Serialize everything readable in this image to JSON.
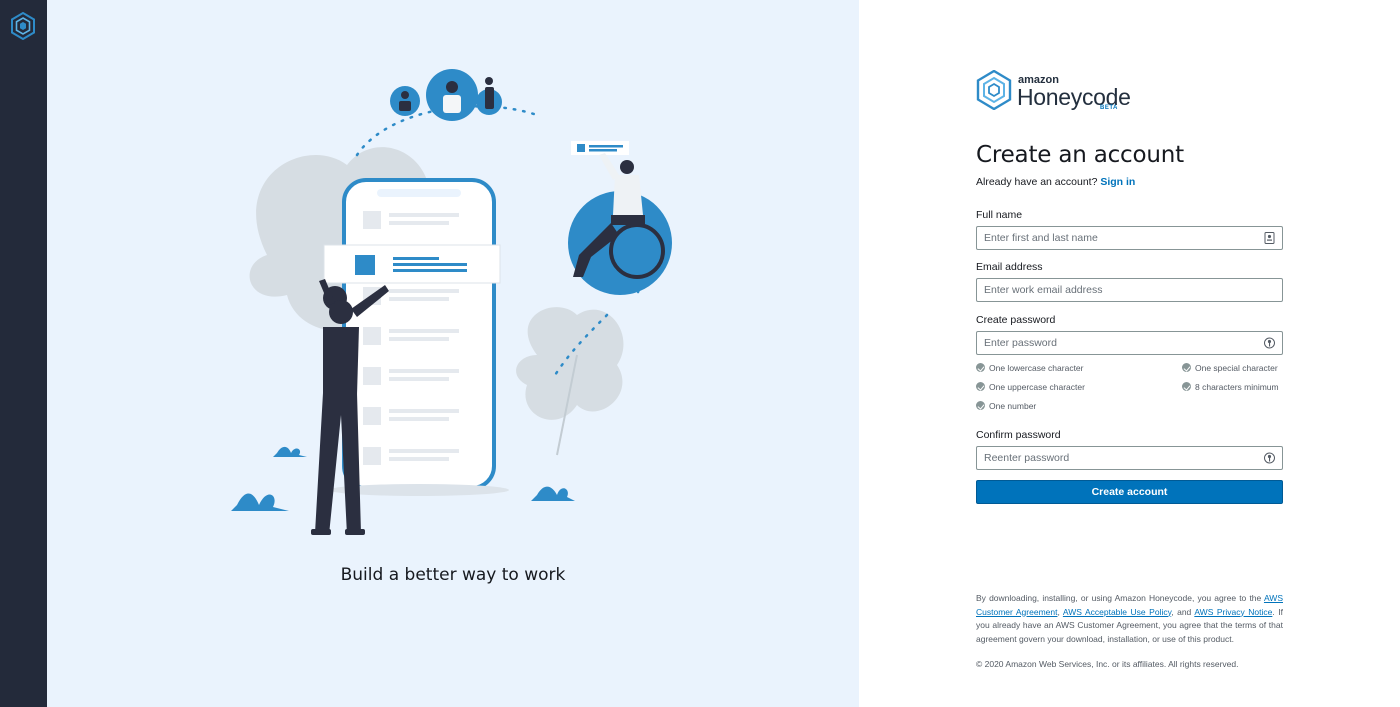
{
  "brand": {
    "amazon": "amazon",
    "name": "Honeycode",
    "beta": "BETA"
  },
  "hero": {
    "tagline": "Build a better way to work"
  },
  "form": {
    "title": "Create an account",
    "signin_prompt": "Already have an account?",
    "signin_link": "Sign in",
    "fullname": {
      "label": "Full name",
      "placeholder": "Enter first and last name",
      "value": ""
    },
    "email": {
      "label": "Email address",
      "placeholder": "Enter work email address",
      "value": ""
    },
    "password": {
      "label": "Create password",
      "placeholder": "Enter password",
      "value": ""
    },
    "confirm": {
      "label": "Confirm password",
      "placeholder": "Reenter password",
      "value": ""
    },
    "rules": [
      "One lowercase character",
      "One special character",
      "One uppercase character",
      "8 characters minimum",
      "One number"
    ],
    "submit_label": "Create account"
  },
  "legal": {
    "prefix": "By downloading, installing, or using Amazon Honeycode, you agree to the",
    "link_customer_agreement": "AWS Customer Agreement",
    "link_acceptable_use": "AWS Acceptable Use Policy",
    "and": ", and",
    "link_privacy": "AWS Privacy Notice",
    "suffix": ". If you already have an AWS Customer Agreement, you agree that the terms of that agreement govern your download, installation, or use of this product.",
    "copyright": "© 2020 Amazon Web Services, Inc. or its affiliates. All rights reserved."
  },
  "colors": {
    "rail": "#232a3a",
    "hero_bg": "#eaf3fd",
    "accent": "#0073bb",
    "illustration_blue": "#2e8bc8",
    "figure_dark": "#2b2f40"
  },
  "icons": {
    "rail_logo": "honeycode-hex-icon",
    "fullname_field": "contact-card-icon",
    "password_field": "password-key-icon",
    "rule": "check-circle-icon"
  }
}
